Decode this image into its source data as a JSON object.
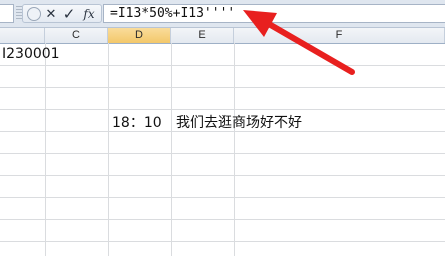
{
  "formula_bar": {
    "cancel_glyph": "✕",
    "enter_glyph": "✓",
    "fx_label": "fx",
    "formula": "=I13*50%+I13''''"
  },
  "columns": [
    {
      "label": ""
    },
    {
      "label": "C"
    },
    {
      "label": "D"
    },
    {
      "label": "E"
    },
    {
      "label": "F"
    }
  ],
  "cells": {
    "b2": "I230001",
    "d6": "18：10",
    "e6": "我们去逛商场好不好"
  },
  "annotation": {
    "arrow_color": "#e8201f"
  }
}
